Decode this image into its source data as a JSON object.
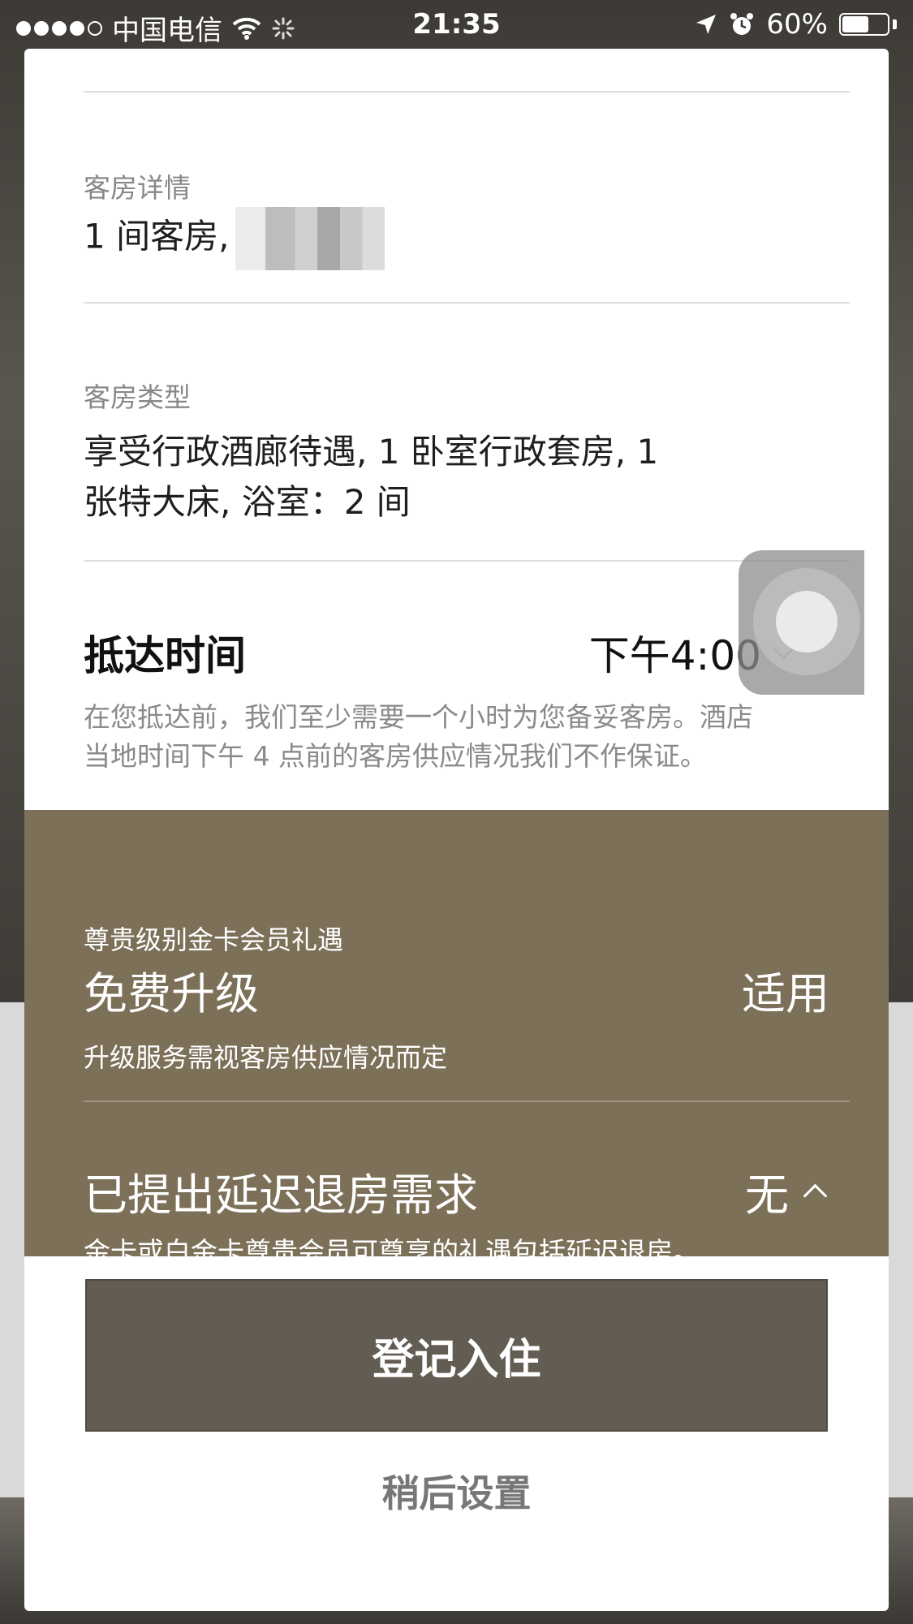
{
  "status_bar": {
    "carrier": "中国电信",
    "time": "21:35",
    "battery_percent": "60%",
    "battery_level": 0.6,
    "signal_filled": 4,
    "signal_total": 5
  },
  "room_details": {
    "label": "客房详情",
    "value": "1 间客房,"
  },
  "room_type": {
    "label": "客房类型",
    "line1": "享受行政酒廊待遇, 1 卧室行政套房, 1",
    "line2": "张特大床, 浴室：2 间"
  },
  "arrival": {
    "title": "抵达时间",
    "time": "下午4:00",
    "note_line1": "在您抵达前，我们至少需要一个小时为您备妥客房。酒店",
    "note_line2": "当地时间下午 4 点前的客房供应情况我们不作保证。"
  },
  "perks": {
    "label": "尊贵级别金卡会员礼遇",
    "upgrade_title": "免费升级",
    "upgrade_status": "适用",
    "upgrade_sub": "升级服务需视客房供应情况而定",
    "late_title": "已提出延迟退房需求",
    "late_status": "无",
    "late_sub": "金卡或白金卡尊贵会员可尊享的礼遇包括延迟退房。"
  },
  "actions": {
    "checkin_label": "登记入住",
    "later_label": "稍后设置"
  },
  "colors": {
    "perks_bg": "#7d7059",
    "button_bg": "#635c52"
  }
}
